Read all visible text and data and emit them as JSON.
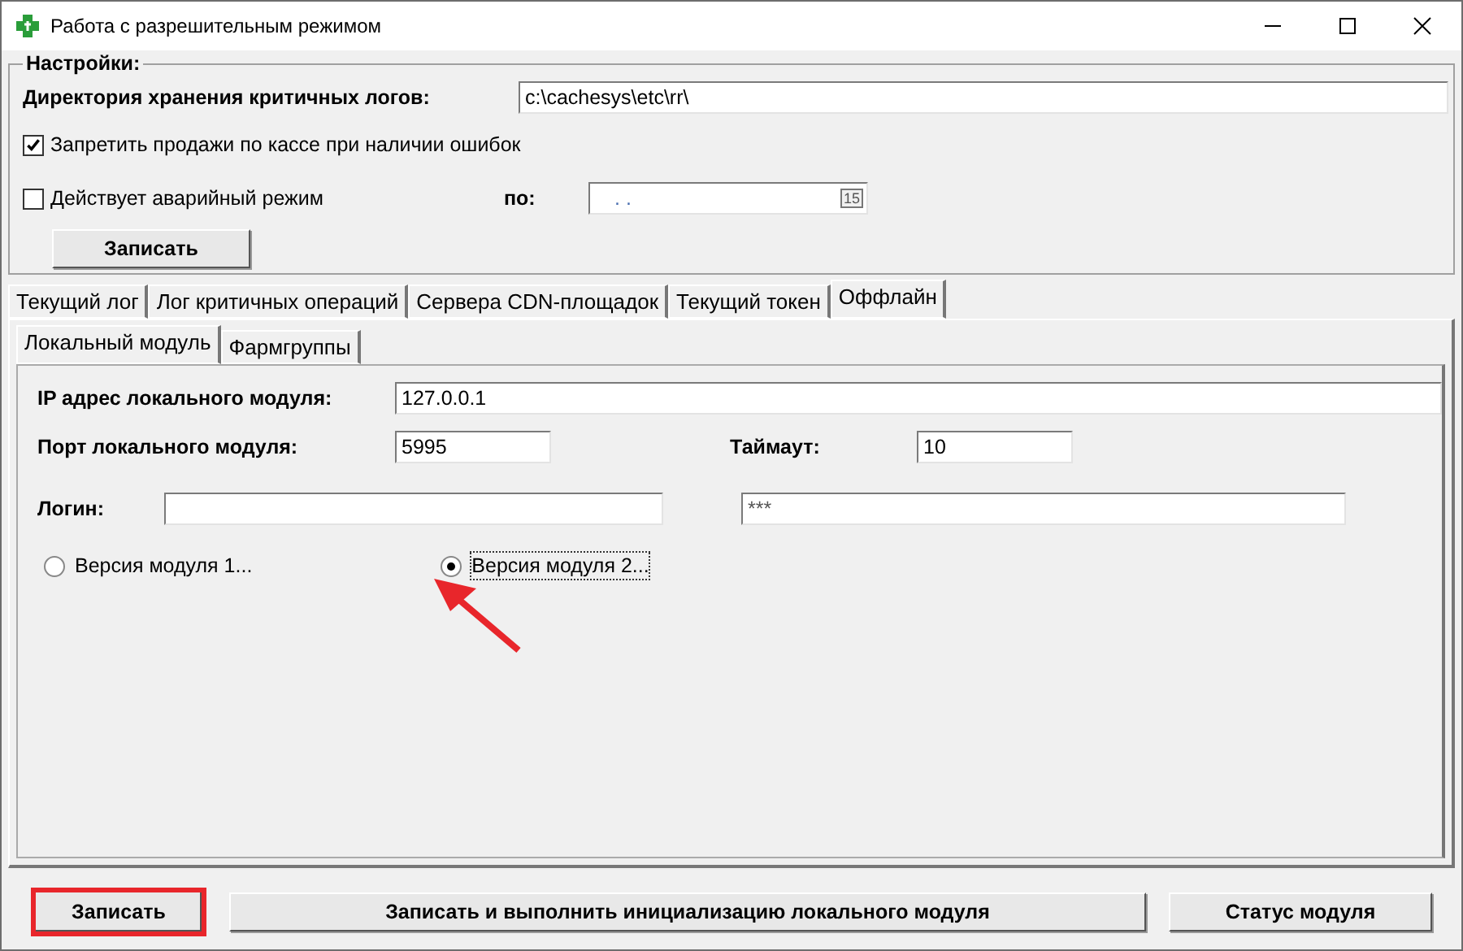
{
  "window": {
    "title": "Работа с разрешительным режимом"
  },
  "settings": {
    "title": "Настройки:",
    "log_dir": {
      "label": "Директория хранения критичных логов:",
      "value": "c:\\cachesys\\etc\\rr\\"
    },
    "forbid_sales": {
      "label": "Запретить продажи по кассе при наличии ошибок",
      "checked": true
    },
    "emergency": {
      "label": "Действует аварийный режим",
      "checked": false
    },
    "until": {
      "label": "по:",
      "value": ". .",
      "calendar": "15"
    },
    "save_button": "Записать"
  },
  "tabs": [
    {
      "label": "Текущий лог",
      "selected": false
    },
    {
      "label": "Лог критичных операций",
      "selected": false
    },
    {
      "label": "Сервера CDN-площадок",
      "selected": false
    },
    {
      "label": "Текущий токен",
      "selected": false
    },
    {
      "label": "Оффлайн",
      "selected": true
    }
  ],
  "subtabs": [
    {
      "label": "Локальный модуль",
      "selected": true
    },
    {
      "label": "Фармгруппы",
      "selected": false
    }
  ],
  "offline": {
    "ip": {
      "label": "IP адрес локального модуля:",
      "value": "127.0.0.1"
    },
    "port": {
      "label": "Порт локального модуля:",
      "value": "5995"
    },
    "timeout": {
      "label": "Таймаут:",
      "value": "10"
    },
    "login": {
      "label": "Логин:"
    },
    "password": {
      "value": "***"
    },
    "versions": [
      {
        "label": "Версия модуля 1...",
        "selected": false
      },
      {
        "label": "Версия модуля 2...",
        "selected": true
      }
    ]
  },
  "buttons": [
    {
      "label": "Записать",
      "highlighted": true
    },
    {
      "label": "Записать и выполнить инициализацию локального модуля",
      "highlighted": false
    },
    {
      "label": "Статус модуля",
      "highlighted": false
    }
  ]
}
